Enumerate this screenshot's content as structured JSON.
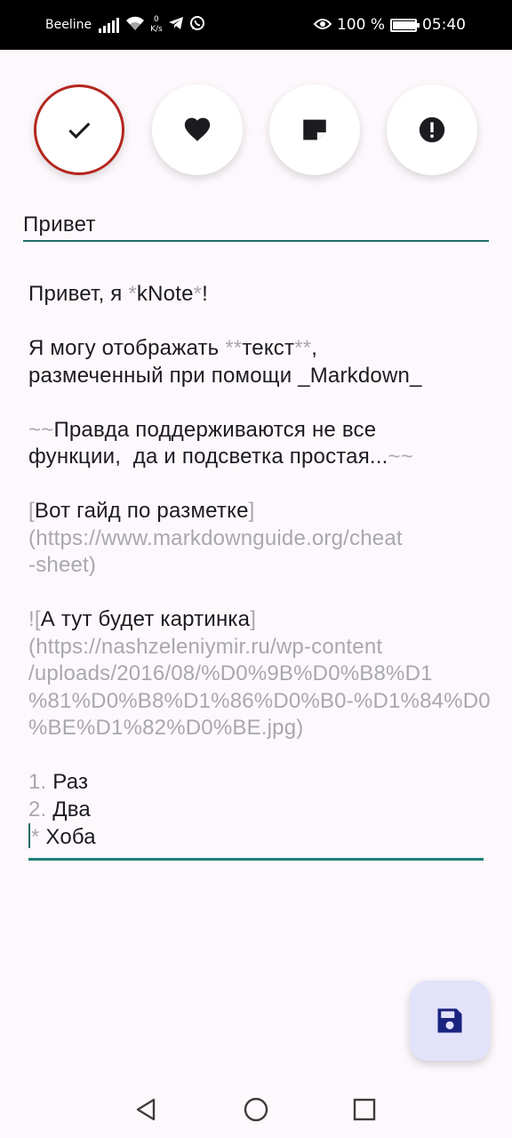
{
  "status_bar": {
    "carrier": "Beeline",
    "net_speed_value": "0",
    "net_speed_unit": "K/s",
    "battery_percent": "100 %",
    "time": "05:40",
    "icons": [
      "signal-icon",
      "wifi-icon",
      "telegram-icon",
      "whatsapp-icon",
      "eye-icon",
      "battery-icon"
    ]
  },
  "tags": [
    {
      "name": "check-icon",
      "selected": true
    },
    {
      "name": "heart-icon",
      "selected": false
    },
    {
      "name": "note-icon",
      "selected": false
    },
    {
      "name": "alert-icon",
      "selected": false
    }
  ],
  "note": {
    "title": "Привет",
    "line1_pre": "Привет, я ",
    "line1_mark_open": "*",
    "line1_word": "kNote",
    "line1_mark_close": "*",
    "line1_post": "!",
    "line2_pre": "Я могу отображать ",
    "line2_mark_open": "**",
    "line2_word": "текст",
    "line2_mark_close": "**",
    "line2_post": ",",
    "line3": "размеченный при помощи _Markdown_",
    "line4_mark_open": "~~",
    "line4_text": "Правда поддерживаются не все",
    "line5_text": "функции,  да и подсветка простая...",
    "line5_mark_close": "~~",
    "line6_bracket_open": "[",
    "line6_text": "Вот гайд по разметке",
    "line6_bracket_close": "]",
    "line7_url": "(https://www.markdownguide.org/cheat",
    "line8_url": "-sheet)",
    "line9_bang": "!",
    "line9_bracket_open": "[",
    "line9_text": "А тут будет картинка",
    "line9_bracket_close": "]",
    "line10_url": "(https://nashzeleniymir.ru/wp-content",
    "line11_url": "/uploads/2016/08/%D0%9B%D0%B8%D1",
    "line12_url": "%81%D0%B8%D1%86%D0%B0-%D1%84%D0",
    "line13_url": "%BE%D1%82%D0%BE.jpg)",
    "list1_marker": "1.",
    "list1_text": " Раз",
    "list2_marker": "2.",
    "list2_text": " Два",
    "list3_marker": "*",
    "list3_text": " Хоба"
  },
  "fab": {
    "icon": "save-icon"
  },
  "nav": {
    "icons": [
      "back-icon",
      "home-icon",
      "recents-icon"
    ]
  },
  "colors": {
    "background": "#fdf8fc",
    "selected_ring": "#b3261e",
    "underline": "#1f6e69",
    "markdown_syntax": "#a8a8ad",
    "fab_bg": "#e2e2fb",
    "fab_icon": "#1a237e"
  }
}
